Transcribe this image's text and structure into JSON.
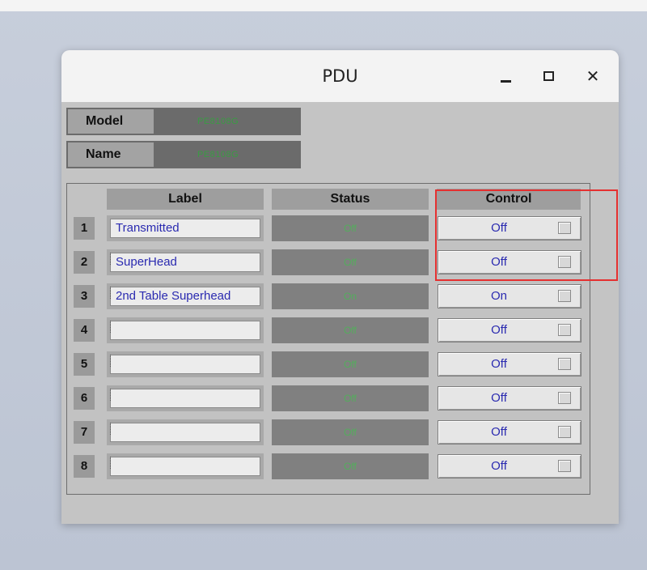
{
  "window": {
    "title": "PDU"
  },
  "info": {
    "model_label": "Model",
    "model_value": "PE8108G",
    "name_label": "Name",
    "name_value": "PE8108G"
  },
  "table": {
    "headers": {
      "label": "Label",
      "status": "Status",
      "control": "Control"
    },
    "rows": [
      {
        "num": "1",
        "label": "Transmitted",
        "status": "Off",
        "control": "Off"
      },
      {
        "num": "2",
        "label": "SuperHead",
        "status": "Off",
        "control": "Off"
      },
      {
        "num": "3",
        "label": "2nd Table Superhead",
        "status": "On",
        "control": "On"
      },
      {
        "num": "4",
        "label": "",
        "status": "Off",
        "control": "Off"
      },
      {
        "num": "5",
        "label": "",
        "status": "Off",
        "control": "Off"
      },
      {
        "num": "6",
        "label": "",
        "status": "Off",
        "control": "Off"
      },
      {
        "num": "7",
        "label": "",
        "status": "Off",
        "control": "Off"
      },
      {
        "num": "8",
        "label": "",
        "status": "Off",
        "control": "Off"
      }
    ]
  },
  "colors": {
    "status_text": "#2ea83a",
    "label_text": "#2a2ab0",
    "highlight": "#e53030"
  }
}
